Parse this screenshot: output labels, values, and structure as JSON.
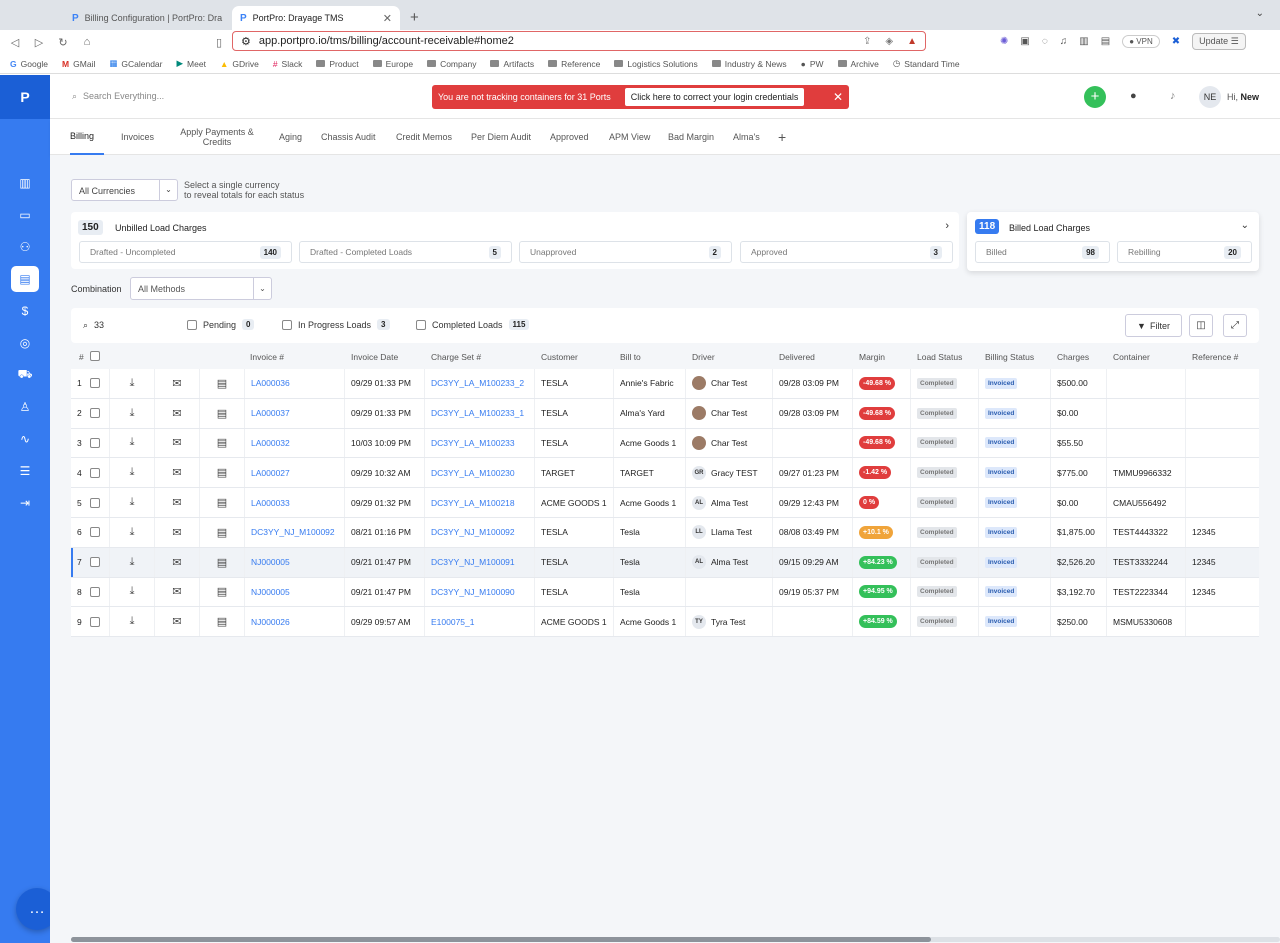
{
  "browser": {
    "tabs": [
      {
        "title": "Billing Configuration | PortPro: Dra"
      },
      {
        "title": "PortPro: Drayage TMS"
      }
    ],
    "url": "app.portpro.io/tms/billing/account-receivable#home2",
    "vpn": "VPN",
    "update": "Update",
    "bookmarks": [
      "Google",
      "GMail",
      "GCalendar",
      "Meet",
      "GDrive",
      "Slack",
      "Product",
      "Europe",
      "Company",
      "Artifacts",
      "Reference",
      "Logistics Solutions",
      "Industry & News",
      "PW",
      "Archive",
      "Standard Time"
    ]
  },
  "sidebar": {
    "logo": "P"
  },
  "topbar": {
    "search_placeholder": "Search Everything...",
    "alert_text": "You are not tracking containers for 31 Ports",
    "alert_button": "Click here to correct your login credentials",
    "user_initials": "NE",
    "greeting": "Hi,",
    "user_name": "New"
  },
  "nav_tabs": [
    "Billing",
    "Invoices",
    "Apply Payments & Credits",
    "Aging",
    "Chassis Audit",
    "Credit Memos",
    "Per Diem Audit",
    "Approved",
    "APM View",
    "Bad Margin",
    "Alma's"
  ],
  "currency": {
    "selected": "All Currencies",
    "hint_line1": "Select a single currency",
    "hint_line2": "to reveal totals for each status"
  },
  "unbilled": {
    "count": "150",
    "title": "Unbilled Load Charges",
    "subs": [
      {
        "label": "Drafted - Uncompleted",
        "count": "140"
      },
      {
        "label": "Drafted - Completed Loads",
        "count": "5"
      },
      {
        "label": "Unapproved",
        "count": "2"
      },
      {
        "label": "Approved",
        "count": "3"
      }
    ]
  },
  "billed": {
    "count": "118",
    "title": "Billed Load Charges",
    "subs": [
      {
        "label": "Billed",
        "count": "98"
      },
      {
        "label": "Rebilling",
        "count": "20"
      }
    ]
  },
  "combination": {
    "label": "Combination",
    "selected": "All Methods"
  },
  "filters": {
    "search_value": "33",
    "pending": {
      "label": "Pending",
      "count": "0"
    },
    "in_progress": {
      "label": "In Progress Loads",
      "count": "3"
    },
    "completed": {
      "label": "Completed Loads",
      "count": "115"
    },
    "filter_button": "Filter"
  },
  "table": {
    "headers": [
      "#",
      "Invoice #",
      "Invoice Date",
      "Charge Set #",
      "Customer",
      "Bill to",
      "Driver",
      "Delivered",
      "Margin",
      "Load Status",
      "Billing Status",
      "Charges",
      "Container",
      "Reference #"
    ],
    "rows": [
      {
        "n": "1",
        "invoice": "LA000036",
        "date": "09/29 01:33 PM",
        "charge_set": "DC3YY_LA_M100233_2",
        "customer": "TESLA",
        "bill_to": "Annie's Fabric",
        "driver": "Char Test",
        "driver_initials": "",
        "delivered": "09/28 03:09 PM",
        "margin": "-49.68 %",
        "margin_color": "#e03d3d",
        "load_status": "Completed",
        "billing_status": "Invoiced",
        "charges": "$500.00",
        "container": "",
        "reference": ""
      },
      {
        "n": "2",
        "invoice": "LA000037",
        "date": "09/29 01:33 PM",
        "charge_set": "DC3YY_LA_M100233_1",
        "customer": "TESLA",
        "bill_to": "Alma's Yard",
        "driver": "Char Test",
        "driver_initials": "",
        "delivered": "09/28 03:09 PM",
        "margin": "-49.68 %",
        "margin_color": "#e03d3d",
        "load_status": "Completed",
        "billing_status": "Invoiced",
        "charges": "$0.00",
        "container": "",
        "reference": ""
      },
      {
        "n": "3",
        "invoice": "LA000032",
        "date": "10/03 10:09 PM",
        "charge_set": "DC3YY_LA_M100233",
        "customer": "TESLA",
        "bill_to": "Acme Goods 1",
        "driver": "Char Test",
        "driver_initials": "",
        "delivered": "",
        "margin": "-49.68 %",
        "margin_color": "#e03d3d",
        "load_status": "Completed",
        "billing_status": "Invoiced",
        "charges": "$55.50",
        "container": "",
        "reference": ""
      },
      {
        "n": "4",
        "invoice": "LA000027",
        "date": "09/29 10:32 AM",
        "charge_set": "DC3YY_LA_M100230",
        "customer": "TARGET",
        "bill_to": "TARGET",
        "driver": "Gracy TEST",
        "driver_initials": "GR",
        "delivered": "09/27 01:23 PM",
        "margin": "-1.42 %",
        "margin_color": "#e03d3d",
        "load_status": "Completed",
        "billing_status": "Invoiced",
        "charges": "$775.00",
        "container": "TMMU9966332",
        "reference": ""
      },
      {
        "n": "5",
        "invoice": "LA000033",
        "date": "09/29 01:32 PM",
        "charge_set": "DC3YY_LA_M100218",
        "customer": "ACME GOODS 1",
        "bill_to": "Acme Goods 1",
        "driver": "Alma Test",
        "driver_initials": "AL",
        "delivered": "09/29 12:43 PM",
        "margin": "0 %",
        "margin_color": "#e03d3d",
        "load_status": "Completed",
        "billing_status": "Invoiced",
        "charges": "$0.00",
        "container": "CMAU556492",
        "reference": ""
      },
      {
        "n": "6",
        "invoice": "DC3YY_NJ_M100092",
        "date": "08/21 01:16 PM",
        "charge_set": "DC3YY_NJ_M100092",
        "customer": "TESLA",
        "bill_to": "Tesla",
        "driver": "Llama Test",
        "driver_initials": "LL",
        "delivered": "08/08 03:49 PM",
        "margin": "+10.1 %",
        "margin_color": "#f0a43a",
        "load_status": "Completed",
        "billing_status": "Invoiced",
        "charges": "$1,875.00",
        "container": "TEST4443322",
        "reference": "12345"
      },
      {
        "n": "7",
        "invoice": "NJ000005",
        "date": "09/21 01:47 PM",
        "charge_set": "DC3YY_NJ_M100091",
        "customer": "TESLA",
        "bill_to": "Tesla",
        "driver": "Alma Test",
        "driver_initials": "AL",
        "delivered": "09/15 09:29 AM",
        "margin": "+84.23 %",
        "margin_color": "#34c05a",
        "load_status": "Completed",
        "billing_status": "Invoiced",
        "charges": "$2,526.20",
        "container": "TEST3332244",
        "reference": "12345"
      },
      {
        "n": "8",
        "invoice": "NJ000005",
        "date": "09/21 01:47 PM",
        "charge_set": "DC3YY_NJ_M100090",
        "customer": "TESLA",
        "bill_to": "Tesla",
        "driver": "",
        "driver_initials": "",
        "delivered": "09/19 05:37 PM",
        "margin": "+94.95 %",
        "margin_color": "#34c05a",
        "load_status": "Completed",
        "billing_status": "Invoiced",
        "charges": "$3,192.70",
        "container": "TEST2223344",
        "reference": "12345"
      },
      {
        "n": "9",
        "invoice": "NJ000026",
        "date": "09/29 09:57 AM",
        "charge_set": "E100075_1",
        "customer": "ACME GOODS 1",
        "bill_to": "Acme Goods 1",
        "driver": "Tyra Test",
        "driver_initials": "TY",
        "delivered": "",
        "margin": "+84.59 %",
        "margin_color": "#34c05a",
        "load_status": "Completed",
        "billing_status": "Invoiced",
        "charges": "$250.00",
        "container": "MSMU5330608",
        "reference": ""
      }
    ]
  }
}
